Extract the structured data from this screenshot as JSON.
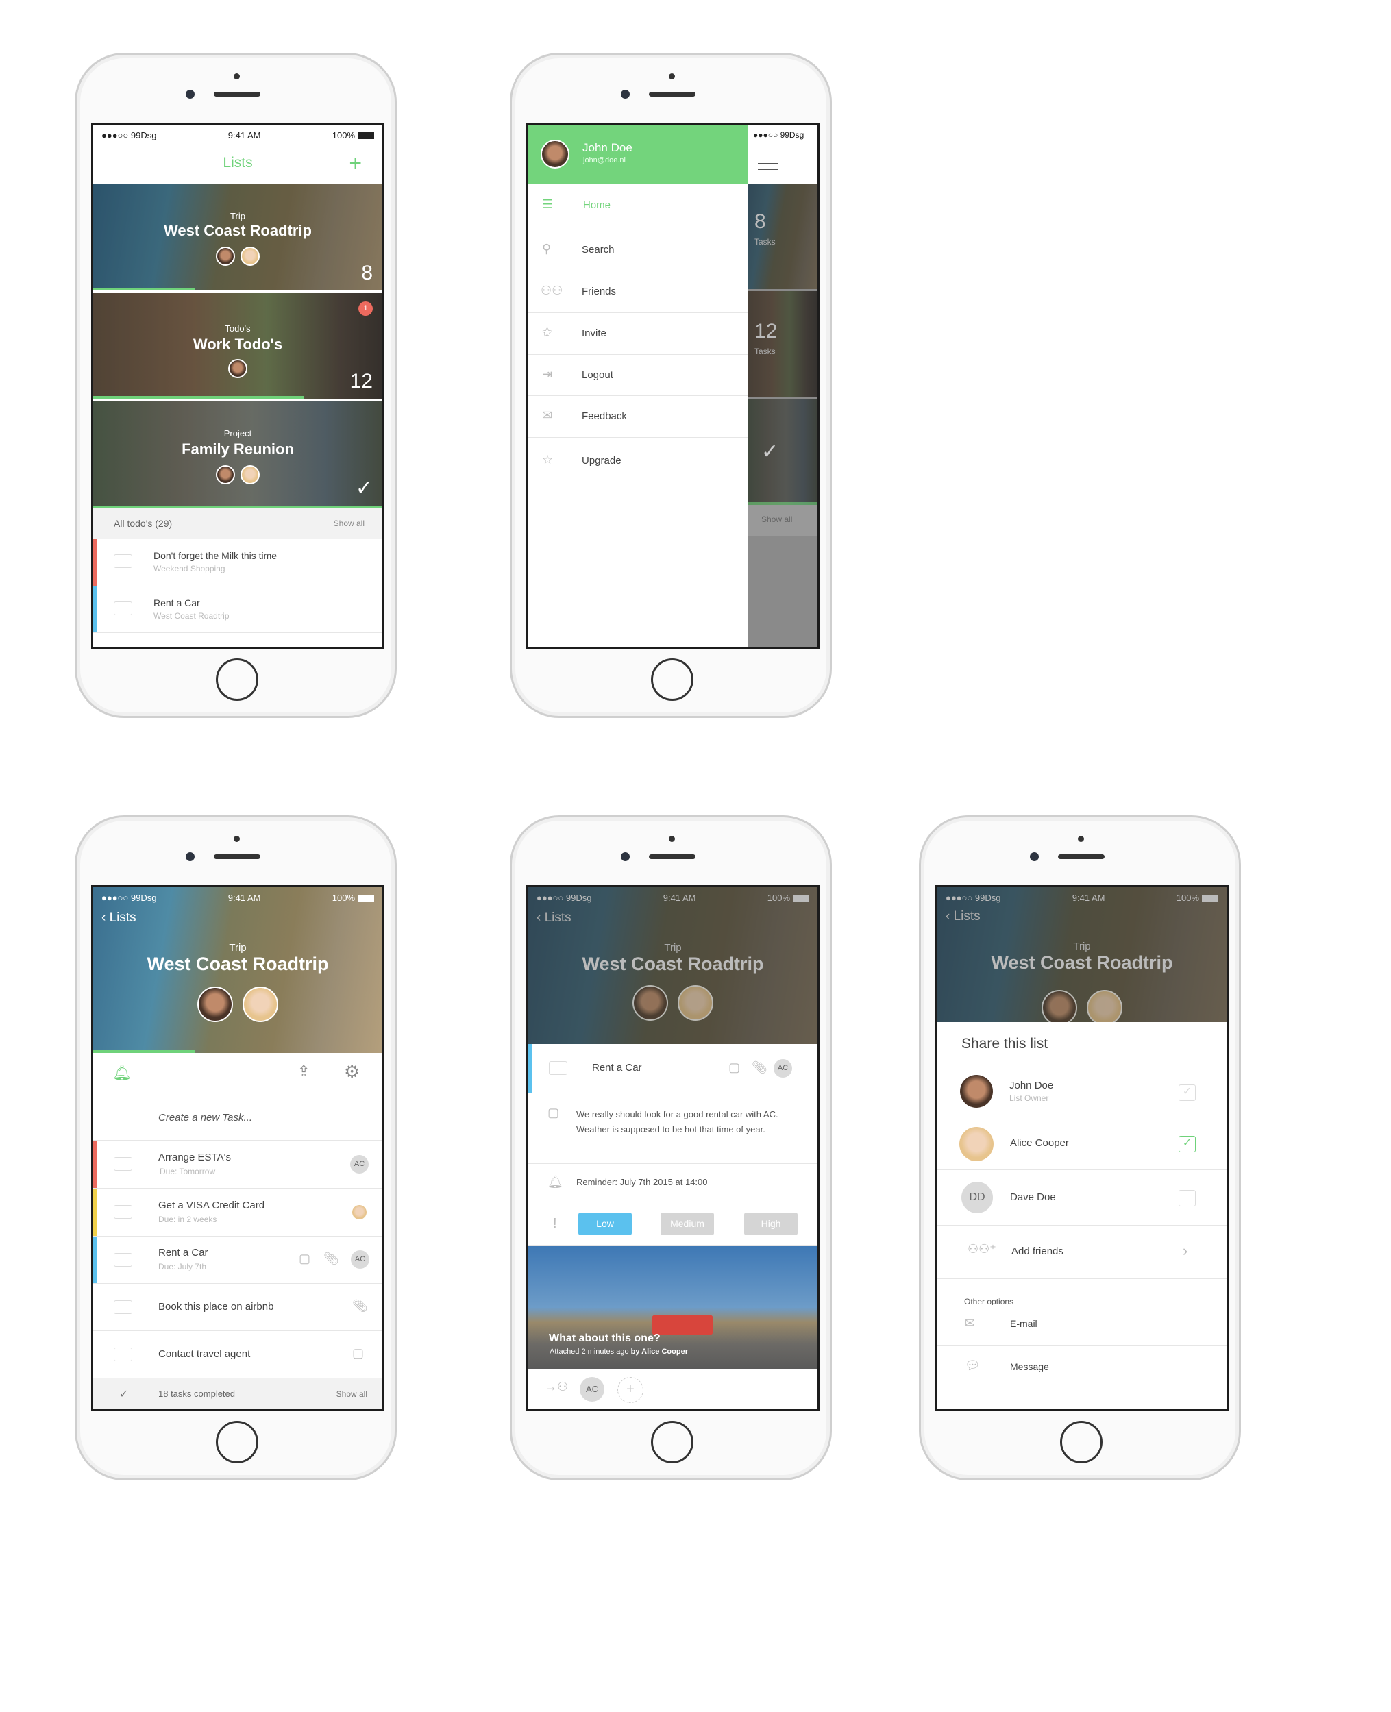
{
  "status": {
    "carrier": "●●●○○ 99Dsg",
    "time": "9:41 AM",
    "battery": "100%"
  },
  "colors": {
    "accent": "#6fd27a",
    "red": "#ec6a5e",
    "yellow": "#f0d04a",
    "blue": "#5bc1ee",
    "gray": "#d5d5d5"
  },
  "lists_screen": {
    "title": "Lists",
    "menu_icon": "hamburger-icon",
    "add_icon": "plus-icon",
    "cards": [
      {
        "type": "Trip",
        "title": "West Coast Roadtrip",
        "count": "8",
        "progress": 0.35
      },
      {
        "type": "Todo's",
        "title": "Work Todo's",
        "count": "12",
        "badge": "1",
        "progress": 0.73
      },
      {
        "type": "Project",
        "title": "Family Reunion",
        "done_icon": "check-icon",
        "progress": 1.0
      }
    ],
    "all_todos": "All todo's (29)",
    "show_all": "Show all",
    "todos": [
      {
        "title": "Don't forget the Milk this time",
        "list": "Weekend Shopping",
        "color": "#ec6a5e"
      },
      {
        "title": "Rent a Car",
        "list": "West Coast Roadtrip",
        "color": "#5bc1ee"
      }
    ]
  },
  "menu_screen": {
    "user": {
      "name": "John Doe",
      "email": "john@doe.nl"
    },
    "items": [
      {
        "label": "Home",
        "icon": "list-icon",
        "active": true
      },
      {
        "label": "Search",
        "icon": "search-icon"
      },
      {
        "label": "Friends",
        "icon": "friends-icon"
      },
      {
        "label": "Invite",
        "icon": "chat-star-icon"
      },
      {
        "label": "Logout",
        "icon": "logout-icon"
      },
      {
        "label": "Feedback",
        "icon": "envelope-icon"
      },
      {
        "label": "Upgrade",
        "icon": "star-icon"
      }
    ],
    "behind": {
      "count1": "8",
      "tasks1": "Tasks",
      "count2": "12",
      "tasks2": "Tasks",
      "show_all": "Show all"
    }
  },
  "list_detail": {
    "back": "Lists",
    "type": "Trip",
    "title": "West Coast Roadtrip",
    "progress": 0.35,
    "create_placeholder": "Create a new Task...",
    "tasks": [
      {
        "title": "Arrange ESTA's",
        "due": "Due: Tomorrow",
        "color": "#ec6a5e",
        "assignee": "AC"
      },
      {
        "title": "Get a VISA Credit Card",
        "due": "Due: in 2 weeks",
        "color": "#f0d04a"
      },
      {
        "title": "Rent a Car",
        "due": "Due: July 7th",
        "color": "#5bc1ee",
        "assignee": "AC"
      },
      {
        "title": "Book this place on airbnb"
      },
      {
        "title": "Contact travel agent"
      }
    ],
    "completed": "18 tasks completed",
    "show_all": "Show all"
  },
  "task_detail": {
    "back": "Lists",
    "type": "Trip",
    "title": "West Coast Roadtrip",
    "task": "Rent a Car",
    "assignee": "AC",
    "note": "We really should look for a good rental car with AC. Weather is supposed to be hot that time of year.",
    "reminder": "Reminder: July 7th 2015 at 14:00",
    "priority": {
      "options": [
        "Low",
        "Medium",
        "High"
      ],
      "selected": "Low"
    },
    "attachment": {
      "title": "What about this one?",
      "meta": "Attached 2 minutes ago",
      "by": "by Alice Cooper"
    },
    "members": [
      "AC"
    ]
  },
  "share_screen": {
    "back": "Lists",
    "type": "Trip",
    "title": "West Coast Roadtrip",
    "heading": "Share this list",
    "people": [
      {
        "name": "John Doe",
        "role": "List Owner",
        "checked": true,
        "disabled": true
      },
      {
        "name": "Alice Cooper",
        "checked": true
      },
      {
        "name": "Dave Doe",
        "initials": "DD",
        "checked": false
      }
    ],
    "add_friends": "Add friends",
    "other_options": "Other options",
    "email": "E-mail",
    "message": "Message"
  }
}
